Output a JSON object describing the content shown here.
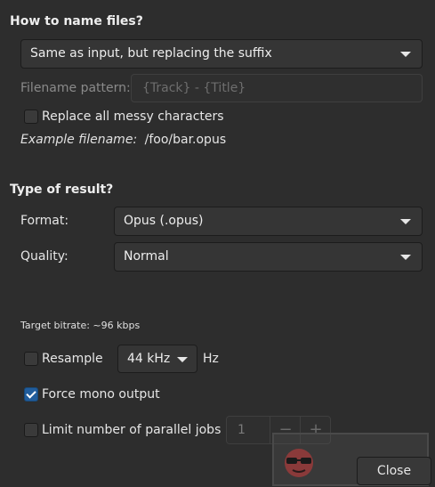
{
  "naming": {
    "title": "How to name files?",
    "mode_value": "Same as input, but replacing the suffix",
    "pattern_label": "Filename pattern:",
    "pattern_placeholder": "{Track} - {Title}",
    "replace_messy_label": "Replace all messy characters",
    "replace_messy_checked": false,
    "example_label": "Example filename:",
    "example_value": "/foo/bar.opus"
  },
  "result": {
    "title": "Type of result?",
    "format_label": "Format:",
    "format_value": "Opus (.opus)",
    "quality_label": "Quality:",
    "quality_value": "Normal",
    "bitrate_text": "Target bitrate: ~96 kbps",
    "resample_label": "Resample",
    "resample_checked": false,
    "resample_rate": "44 kHz",
    "resample_unit": "Hz",
    "mono_label": "Force mono output",
    "mono_checked": true,
    "jobs_label": "Limit number of parallel jobs",
    "jobs_checked": false,
    "jobs_value": "1",
    "jobs_minus": "−",
    "jobs_plus": "+"
  },
  "footer": {
    "close_label": "Close"
  },
  "colors": {
    "background": "#2d2d2d",
    "accent": "#215d9c"
  }
}
